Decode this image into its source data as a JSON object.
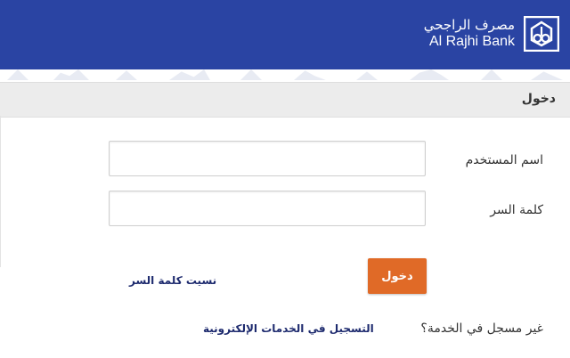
{
  "header": {
    "bank_name_ar": "مصرف الراجحي",
    "bank_name_en": "Al Rajhi Bank",
    "logo_icon": "al-rajhi-logo-icon",
    "background_color": "#2a44a3"
  },
  "section": {
    "title": "دخول"
  },
  "form": {
    "username_label": "اسم المستخدم",
    "username_value": "",
    "password_label": "كلمة السر",
    "password_value": "",
    "login_button_label": "دخول",
    "login_button_color": "#e06a27",
    "forgot_password_link": "نسيت كلمة السر"
  },
  "footer": {
    "not_registered_text": "غير مسجل في الخدمة؟",
    "register_link": "التسجيل في الخدمات الإلكترونية"
  }
}
